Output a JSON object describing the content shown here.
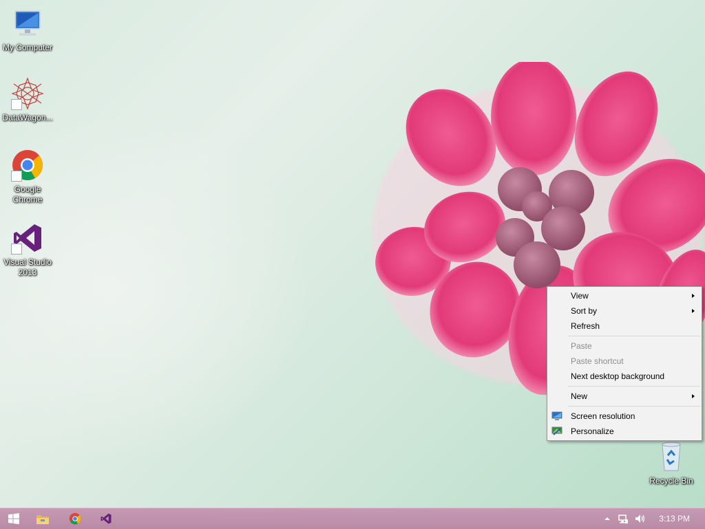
{
  "desktop": {
    "icons": [
      {
        "label": "My Computer",
        "icon": "computer-icon"
      },
      {
        "label": "DataWagon...",
        "icon": "datawagon-icon"
      },
      {
        "label": "Google Chrome",
        "icon": "chrome-icon"
      },
      {
        "label": "Visual Studio 2013",
        "icon": "visual-studio-icon"
      },
      {
        "label": "Recycle Bin",
        "icon": "recycle-bin-icon"
      }
    ]
  },
  "context_menu": {
    "items": [
      {
        "label": "View",
        "submenu": true,
        "enabled": true
      },
      {
        "label": "Sort by",
        "submenu": true,
        "enabled": true
      },
      {
        "label": "Refresh",
        "enabled": true
      },
      {
        "label": "Paste",
        "enabled": false
      },
      {
        "label": "Paste shortcut",
        "enabled": false
      },
      {
        "label": "Next desktop background",
        "enabled": true
      },
      {
        "label": "New",
        "submenu": true,
        "enabled": true
      },
      {
        "label": "Screen resolution",
        "icon": "screen-resolution-icon",
        "enabled": true
      },
      {
        "label": "Personalize",
        "icon": "personalize-icon",
        "enabled": true
      }
    ]
  },
  "taskbar": {
    "clock": "3:13 PM",
    "pinned": [
      "start-icon",
      "file-explorer-icon",
      "chrome-icon",
      "visual-studio-icon"
    ],
    "tray": [
      "show-hidden-icons-icon",
      "network-icon",
      "volume-icon"
    ]
  },
  "colors": {
    "taskbar": "#c69ab3",
    "menu_background": "#f2f2f2",
    "menu_disabled_text": "#8d8d8d",
    "flower_pink": "#e8427f"
  }
}
